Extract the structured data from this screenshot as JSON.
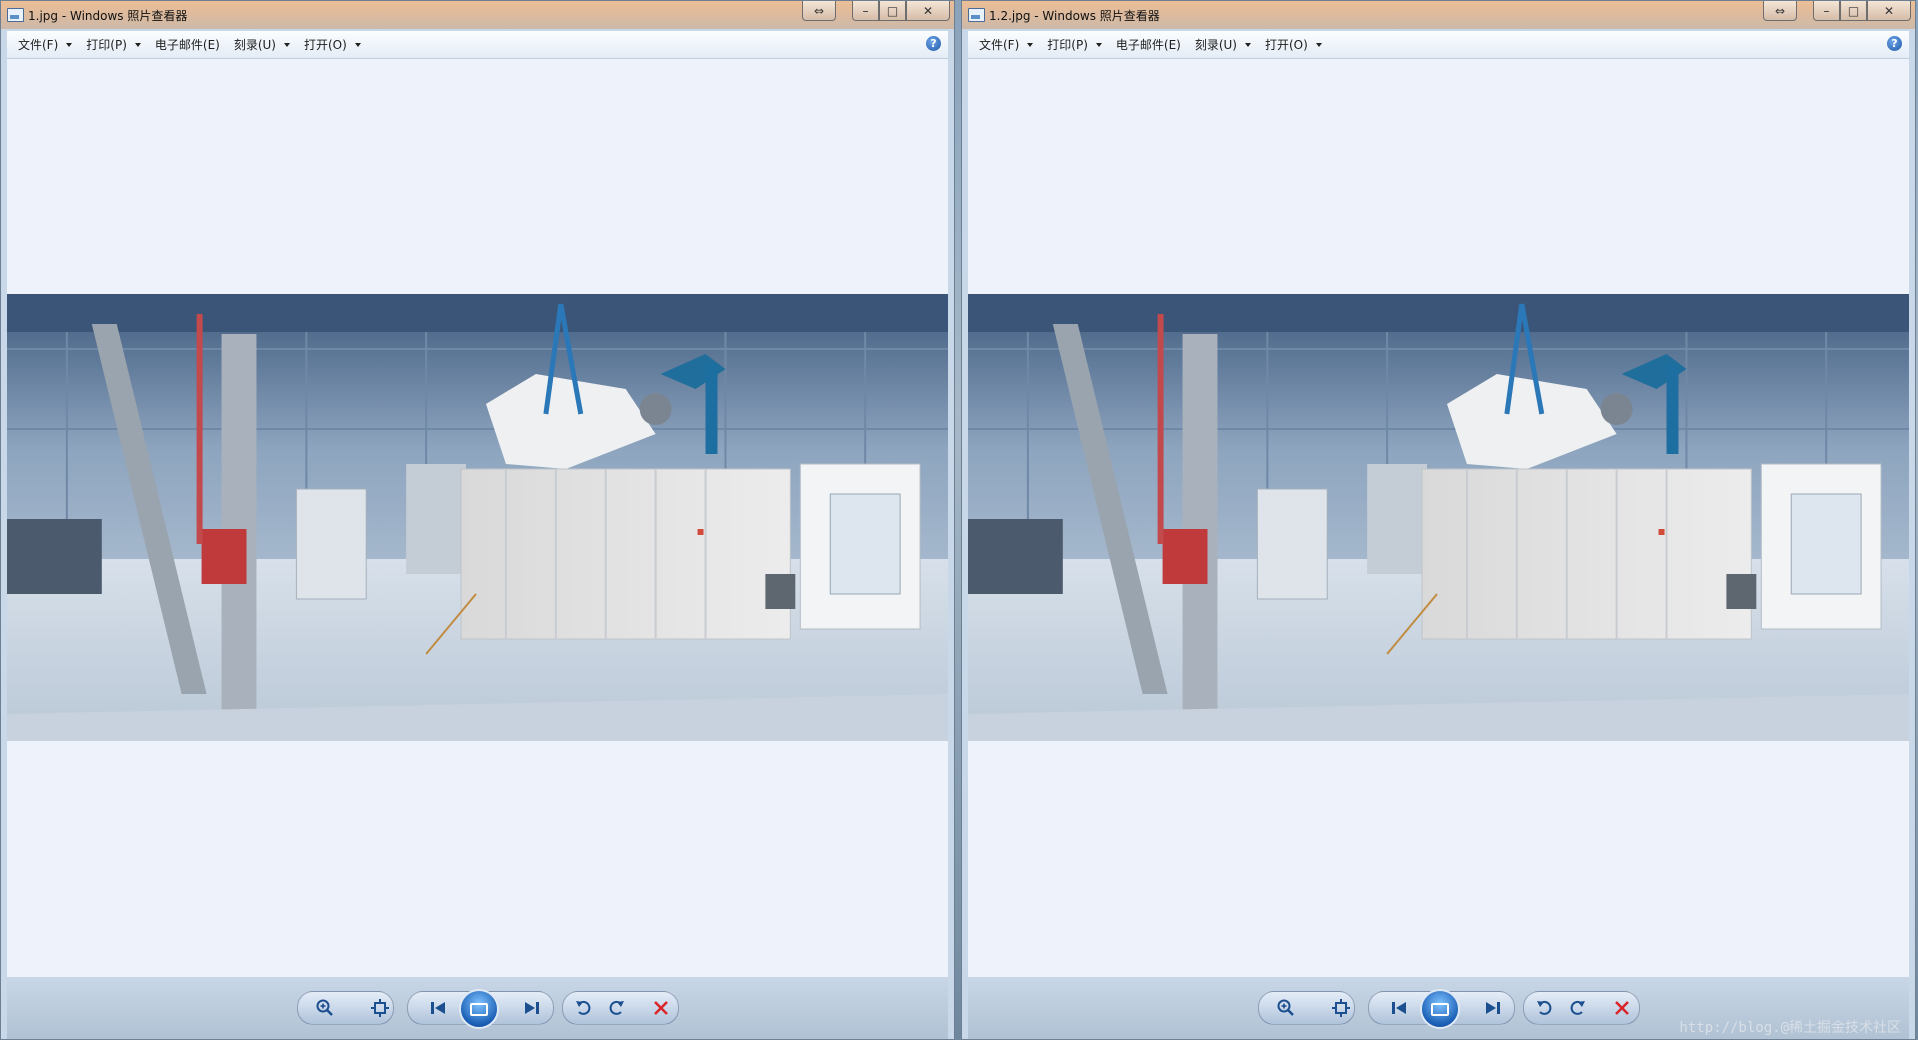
{
  "windows": [
    {
      "title": "1.jpg - Windows 照片查看器",
      "menu": [
        {
          "label": "文件(F)",
          "has_caret": true
        },
        {
          "label": "打印(P)",
          "has_caret": true
        },
        {
          "label": "电子邮件(E)",
          "has_caret": false
        },
        {
          "label": "刻录(U)",
          "has_caret": true
        },
        {
          "label": "打开(O)",
          "has_caret": true
        }
      ],
      "help_icon": "?"
    },
    {
      "title": "1.2.jpg - Windows 照片查看器",
      "menu": [
        {
          "label": "文件(F)",
          "has_caret": true
        },
        {
          "label": "打印(P)",
          "has_caret": true
        },
        {
          "label": "电子邮件(E)",
          "has_caret": false
        },
        {
          "label": "刻录(U)",
          "has_caret": true
        },
        {
          "label": "打开(O)",
          "has_caret": true
        }
      ],
      "help_icon": "?"
    }
  ],
  "caption_buttons": {
    "restore": "⇔",
    "minimize": "–",
    "maximize": "□",
    "close": "✕"
  },
  "toolbar_icons": [
    "zoom-icon",
    "actual-size-icon",
    "previous-icon",
    "slideshow-icon",
    "next-icon",
    "rotate-left-icon",
    "rotate-right-icon",
    "delete-icon"
  ],
  "watermark": "http://blog.@稀土掘金技术社区",
  "colors": {
    "title_bar": "#e3b892",
    "viewer_bg": "#eef3fb",
    "delete_red": "#d9262c",
    "toolbar_blue": "#1b5fb6"
  }
}
